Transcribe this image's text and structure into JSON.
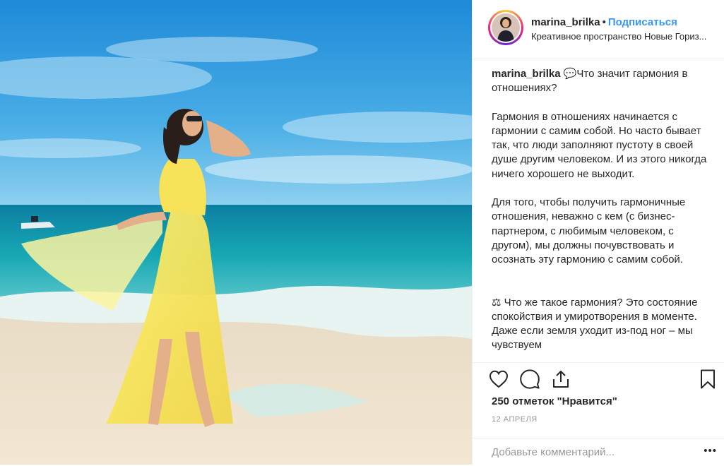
{
  "header": {
    "username": "marina_brilka",
    "separator": "•",
    "follow_label": "Подписаться",
    "location": "Креативное пространство Новые Гориз..."
  },
  "caption": {
    "username": "marina_brilka",
    "paragraphs": [
      "💬Что значит гармония в отношениях?",
      "Гармония в отношениях начинается с гармонии с самим собой. Но часто бывает так, что люди заполняют пустоту в своей душе другим человеком. И из этого никогда ничего хорошего не выходит.",
      "Для того, чтобы получить гармоничные отношения, неважно с кем (с бизнес-партнером, с любимым человеком, с другом), мы должны почувствовать и осознать эту гармонию с самим собой.",
      "⚖ Что же такое гармония? Это состояние спокойствия и умиротворения в моменте. Даже если земля уходит из-под ног – мы чувствуем"
    ]
  },
  "actions": {
    "icons": [
      "heart-icon",
      "comment-icon",
      "share-icon",
      "bookmark-icon"
    ],
    "likes": "250 отметок \"Нравится\"",
    "date": "12 АПРЕЛЯ"
  },
  "comment": {
    "placeholder": "Добавьте комментарий...",
    "more_label": "•••"
  },
  "colors": {
    "accent": "#3897f0",
    "text": "#262626",
    "muted": "#999999",
    "divider": "#efefef"
  }
}
